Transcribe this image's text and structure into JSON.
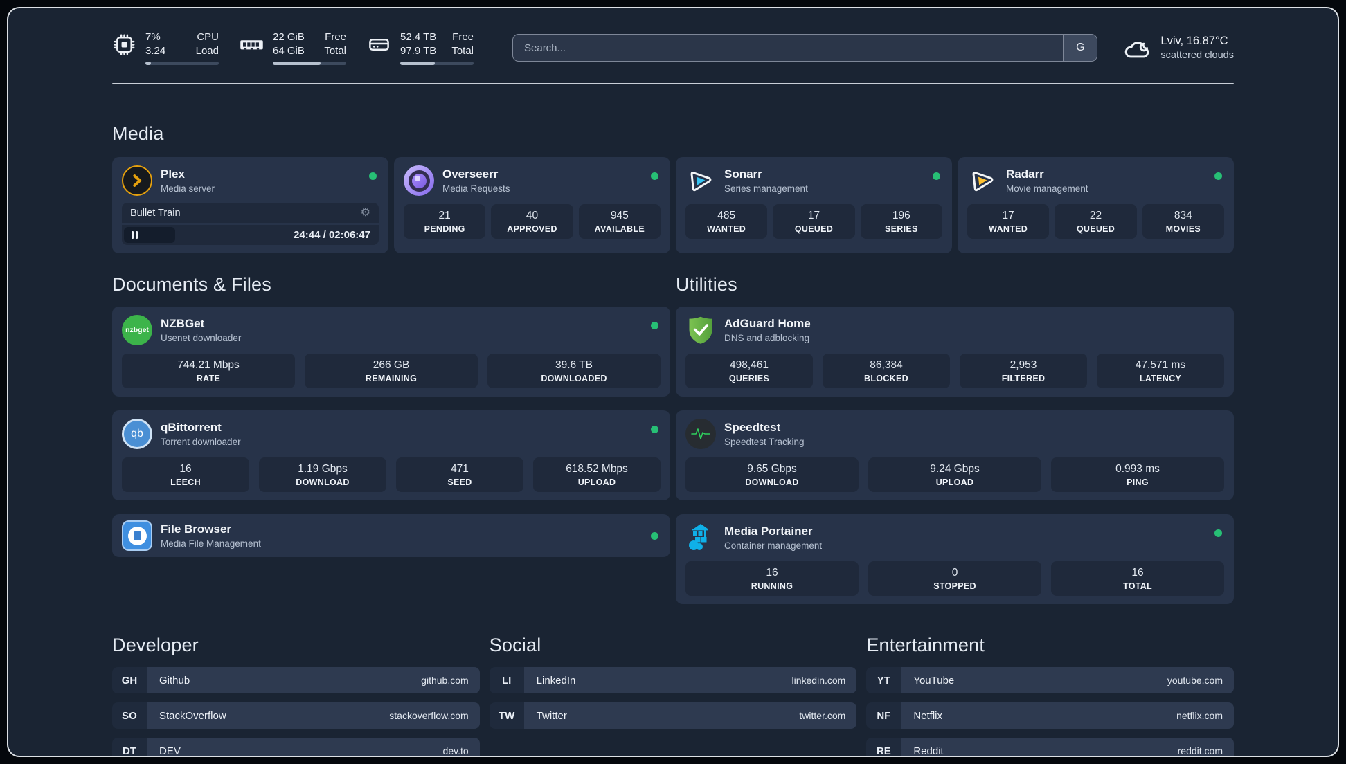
{
  "topbar": {
    "cpu": {
      "value1": "7%",
      "value2": "3.24",
      "label1": "CPU",
      "label2": "Load",
      "progress_pct": 8
    },
    "memory": {
      "value1": "22 GiB",
      "value2": "64 GiB",
      "label1": "Free",
      "label2": "Total",
      "progress_pct": 65
    },
    "storage": {
      "value1": "52.4 TB",
      "value2": "97.9 TB",
      "label1": "Free",
      "label2": "Total",
      "progress_pct": 47
    },
    "search": {
      "placeholder": "Search...",
      "provider_label": "G"
    },
    "weather": {
      "location": "Lviv, 16.87°C",
      "condition": "scattered clouds"
    }
  },
  "media": {
    "title": "Media",
    "plex": {
      "name": "Plex",
      "subtitle": "Media server",
      "now_playing": "Bullet Train",
      "time": "24:44 / 02:06:47",
      "progress_pct": 20
    },
    "overseerr": {
      "name": "Overseerr",
      "subtitle": "Media Requests",
      "stats": [
        {
          "value": "21",
          "label": "PENDING"
        },
        {
          "value": "40",
          "label": "APPROVED"
        },
        {
          "value": "945",
          "label": "AVAILABLE"
        }
      ]
    },
    "sonarr": {
      "name": "Sonarr",
      "subtitle": "Series management",
      "stats": [
        {
          "value": "485",
          "label": "WANTED"
        },
        {
          "value": "17",
          "label": "QUEUED"
        },
        {
          "value": "196",
          "label": "SERIES"
        }
      ]
    },
    "radarr": {
      "name": "Radarr",
      "subtitle": "Movie management",
      "stats": [
        {
          "value": "17",
          "label": "WANTED"
        },
        {
          "value": "22",
          "label": "QUEUED"
        },
        {
          "value": "834",
          "label": "MOVIES"
        }
      ]
    }
  },
  "documents": {
    "title": "Documents & Files",
    "nzbget": {
      "name": "NZBGet",
      "subtitle": "Usenet downloader",
      "icon_text": "nzbget",
      "stats": [
        {
          "value": "744.21 Mbps",
          "label": "RATE"
        },
        {
          "value": "266 GB",
          "label": "REMAINING"
        },
        {
          "value": "39.6 TB",
          "label": "DOWNLOADED"
        }
      ]
    },
    "qbittorrent": {
      "name": "qBittorrent",
      "subtitle": "Torrent downloader",
      "icon_text": "qb",
      "stats": [
        {
          "value": "16",
          "label": "LEECH"
        },
        {
          "value": "1.19 Gbps",
          "label": "DOWNLOAD"
        },
        {
          "value": "471",
          "label": "SEED"
        },
        {
          "value": "618.52 Mbps",
          "label": "UPLOAD"
        }
      ]
    },
    "filebrowser": {
      "name": "File Browser",
      "subtitle": "Media File Management"
    }
  },
  "utilities": {
    "title": "Utilities",
    "adguard": {
      "name": "AdGuard Home",
      "subtitle": "DNS and adblocking",
      "stats": [
        {
          "value": "498,461",
          "label": "QUERIES"
        },
        {
          "value": "86,384",
          "label": "BLOCKED"
        },
        {
          "value": "2,953",
          "label": "FILTERED"
        },
        {
          "value": "47.571 ms",
          "label": "LATENCY"
        }
      ]
    },
    "speedtest": {
      "name": "Speedtest",
      "subtitle": "Speedtest Tracking",
      "stats": [
        {
          "value": "9.65 Gbps",
          "label": "DOWNLOAD"
        },
        {
          "value": "9.24 Gbps",
          "label": "UPLOAD"
        },
        {
          "value": "0.993 ms",
          "label": "PING"
        }
      ]
    },
    "portainer": {
      "name": "Media Portainer",
      "subtitle": "Container management",
      "stats": [
        {
          "value": "16",
          "label": "RUNNING"
        },
        {
          "value": "0",
          "label": "STOPPED"
        },
        {
          "value": "16",
          "label": "TOTAL"
        }
      ]
    }
  },
  "bookmarks": {
    "developer": {
      "title": "Developer",
      "items": [
        {
          "abbr": "GH",
          "name": "Github",
          "url": "github.com"
        },
        {
          "abbr": "SO",
          "name": "StackOverflow",
          "url": "stackoverflow.com"
        },
        {
          "abbr": "DT",
          "name": "DEV",
          "url": "dev.to"
        }
      ]
    },
    "social": {
      "title": "Social",
      "items": [
        {
          "abbr": "LI",
          "name": "LinkedIn",
          "url": "linkedin.com"
        },
        {
          "abbr": "TW",
          "name": "Twitter",
          "url": "twitter.com"
        }
      ]
    },
    "entertainment": {
      "title": "Entertainment",
      "items": [
        {
          "abbr": "YT",
          "name": "YouTube",
          "url": "youtube.com"
        },
        {
          "abbr": "NF",
          "name": "Netflix",
          "url": "netflix.com"
        },
        {
          "abbr": "RE",
          "name": "Reddit",
          "url": "reddit.com"
        }
      ]
    }
  },
  "colors": {
    "status_green": "#27bf75",
    "plex_gold": "#e5a00d",
    "sonarr_blue": "#35c5f4",
    "radarr_yellow": "#ffc230",
    "nzbget_green": "#3cb44a",
    "qbittorrent_blue": "#4a8fd4",
    "filebrowser_blue": "#3f8fe0",
    "adguard_green": "#67b64a",
    "speedtest_green": "#2fd05e",
    "portainer_blue": "#0fb0e8",
    "overseerr_purple": "#7c5ce0"
  }
}
